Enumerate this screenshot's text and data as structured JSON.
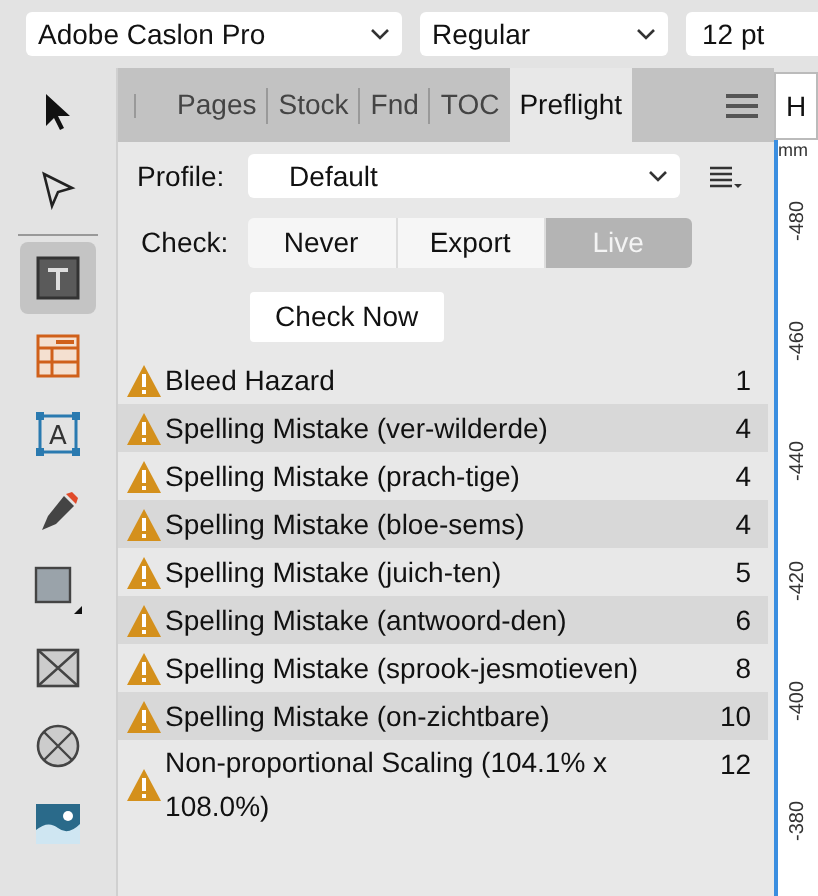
{
  "toolbar": {
    "font_family": "Adobe Caslon Pro",
    "font_style": "Regular",
    "font_size": "12 pt"
  },
  "tools": [
    {
      "kind": "move",
      "selected": false
    },
    {
      "kind": "node",
      "selected": false
    },
    {
      "kind": "text",
      "selected": true
    },
    {
      "kind": "table",
      "selected": false
    },
    {
      "kind": "frame-text",
      "selected": false,
      "glyph": "A"
    },
    {
      "kind": "pen",
      "selected": false
    },
    {
      "kind": "rectangle",
      "selected": false
    },
    {
      "kind": "picture-frame",
      "selected": false
    },
    {
      "kind": "ellipse-frame",
      "selected": false
    },
    {
      "kind": "image",
      "selected": false
    }
  ],
  "panel": {
    "tabs": [
      {
        "label": "Pages",
        "selected": false
      },
      {
        "label": "Stock",
        "selected": false
      },
      {
        "label": "Fnd",
        "selected": false
      },
      {
        "label": "TOC",
        "selected": false
      },
      {
        "label": "Preflight",
        "selected": true
      }
    ],
    "profile_label": "Profile:",
    "profile_value": "Default",
    "check_label": "Check:",
    "check_options": [
      {
        "label": "Never",
        "selected": false
      },
      {
        "label": "Export",
        "selected": false
      },
      {
        "label": "Live",
        "selected": true
      }
    ],
    "check_now": "Check Now",
    "issues": [
      {
        "text": "Bleed Hazard",
        "count": "1"
      },
      {
        "text": "Spelling Mistake (ver-wilderde)",
        "count": "4"
      },
      {
        "text": "Spelling Mistake (prach-tige)",
        "count": "4"
      },
      {
        "text": "Spelling Mistake (bloe-sems)",
        "count": "4"
      },
      {
        "text": "Spelling Mistake (juich-ten)",
        "count": "5"
      },
      {
        "text": "Spelling Mistake (antwoord-den)",
        "count": "6"
      },
      {
        "text": "Spelling Mistake (sprook-jesmotieven)",
        "count": "8"
      },
      {
        "text": "Spelling Mistake (on-zichtbare)",
        "count": "10"
      },
      {
        "text": "Non-proportional Scaling (104.1% x 108.0%)",
        "count": "12"
      }
    ]
  },
  "right": {
    "tab": "H",
    "unit": "mm",
    "ruler_labels": [
      "-480",
      "-460",
      "-440",
      "-420",
      "-400",
      "-380"
    ]
  }
}
